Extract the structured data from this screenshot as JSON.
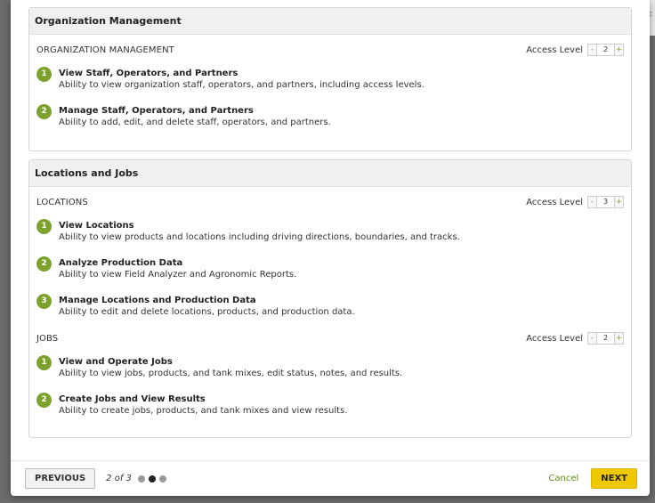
{
  "backdrop": {
    "edge_text": "F"
  },
  "panels": [
    {
      "header": "Organization Management",
      "sections": [
        {
          "title": "ORGANIZATION MANAGEMENT",
          "access_label": "Access Level",
          "access_value": "2",
          "minus": "-",
          "plus": "+",
          "permissions": [
            {
              "num": "1",
              "title": "View Staff, Operators, and Partners",
              "desc": "Ability to view organization staff, operators, and partners, including access levels."
            },
            {
              "num": "2",
              "title": "Manage Staff, Operators, and Partners",
              "desc": "Ability to add, edit, and delete staff, operators, and partners."
            }
          ]
        }
      ]
    },
    {
      "header": "Locations and Jobs",
      "sections": [
        {
          "title": "LOCATIONS",
          "access_label": "Access Level",
          "access_value": "3",
          "minus": "-",
          "plus": "+",
          "permissions": [
            {
              "num": "1",
              "title": "View Locations",
              "desc": "Ability to view products and locations including driving directions, boundaries, and tracks."
            },
            {
              "num": "2",
              "title": "Analyze Production Data",
              "desc": "Ability to view Field Analyzer and Agronomic Reports."
            },
            {
              "num": "3",
              "title": "Manage Locations and Production Data",
              "desc": "Ability to edit and delete locations, products, and production data."
            }
          ]
        },
        {
          "title": "JOBS",
          "access_label": "Access Level",
          "access_value": "2",
          "minus": "-",
          "plus": "+",
          "permissions": [
            {
              "num": "1",
              "title": "View and Operate Jobs",
              "desc": "Ability to view jobs, products, and tank mixes, edit status, notes, and results."
            },
            {
              "num": "2",
              "title": "Create Jobs and View Results",
              "desc": "Ability to create jobs, products, and tank mixes and view results."
            }
          ]
        }
      ]
    }
  ],
  "footer": {
    "previous_label": "PREVIOUS",
    "pager_text": "2 of 3",
    "page_count": 3,
    "current_page": 2,
    "cancel_label": "Cancel",
    "next_label": "NEXT"
  },
  "colors": {
    "accent_green": "#7ca22d",
    "next_yellow": "#f0c800",
    "cancel_green": "#5c8a1e"
  }
}
